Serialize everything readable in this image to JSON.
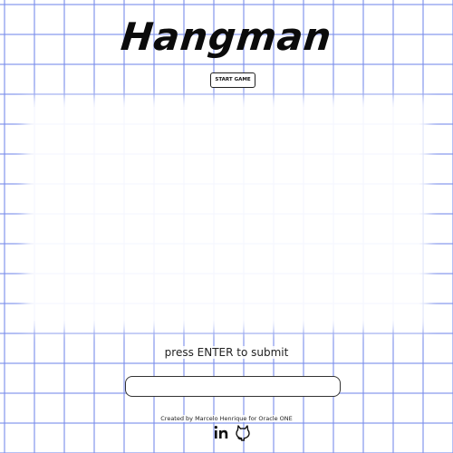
{
  "header": {
    "title": "Hangman",
    "start_button_label": "START GAME"
  },
  "game": {
    "hint": "press ENTER to submit",
    "input_value": "",
    "input_placeholder": ""
  },
  "footer": {
    "credit": "Created by Marcelo Henrique for Oracle ONE",
    "social_links": [
      "linkedin-icon",
      "github-icon"
    ]
  },
  "colors": {
    "grid_line": "#788ceb",
    "text": "#111111",
    "background": "#ffffff"
  }
}
